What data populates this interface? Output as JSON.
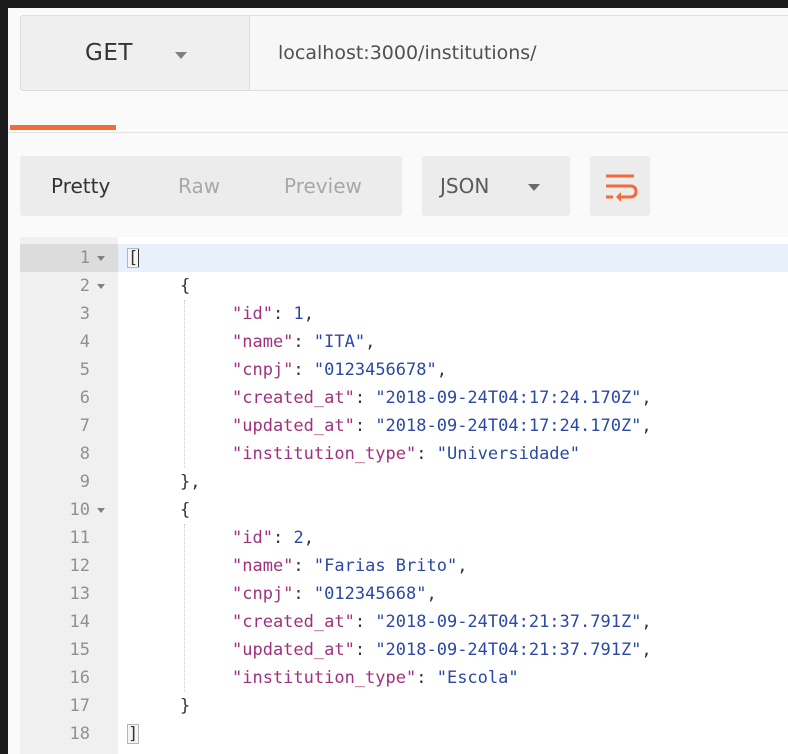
{
  "request": {
    "method": "GET",
    "url": "localhost:3000/institutions/"
  },
  "response_toolbar": {
    "views": [
      "Pretty",
      "Raw",
      "Preview"
    ],
    "active_view": "Pretty",
    "format": "JSON",
    "wrap_icon": "wrap-lines-icon"
  },
  "colors": {
    "accent": "#f26b3a",
    "json_key": "#a0317e",
    "json_value": "#2b49a5"
  },
  "code_lines": [
    {
      "num": "1",
      "indent": 0,
      "fold": true,
      "active": true,
      "tokens": [
        {
          "t": "p",
          "v": "["
        }
      ]
    },
    {
      "num": "2",
      "indent": 1,
      "fold": true,
      "tokens": [
        {
          "t": "p",
          "v": "{"
        }
      ]
    },
    {
      "num": "3",
      "indent": 2,
      "tokens": [
        {
          "t": "k",
          "v": "\"id\""
        },
        {
          "t": "p",
          "v": ": "
        },
        {
          "t": "n",
          "v": "1"
        },
        {
          "t": "p",
          "v": ","
        }
      ]
    },
    {
      "num": "4",
      "indent": 2,
      "tokens": [
        {
          "t": "k",
          "v": "\"name\""
        },
        {
          "t": "p",
          "v": ": "
        },
        {
          "t": "s",
          "v": "\"ITA\""
        },
        {
          "t": "p",
          "v": ","
        }
      ]
    },
    {
      "num": "5",
      "indent": 2,
      "tokens": [
        {
          "t": "k",
          "v": "\"cnpj\""
        },
        {
          "t": "p",
          "v": ": "
        },
        {
          "t": "s",
          "v": "\"0123456678\""
        },
        {
          "t": "p",
          "v": ","
        }
      ]
    },
    {
      "num": "6",
      "indent": 2,
      "tokens": [
        {
          "t": "k",
          "v": "\"created_at\""
        },
        {
          "t": "p",
          "v": ": "
        },
        {
          "t": "s",
          "v": "\"2018-09-24T04:17:24.170Z\""
        },
        {
          "t": "p",
          "v": ","
        }
      ]
    },
    {
      "num": "7",
      "indent": 2,
      "tokens": [
        {
          "t": "k",
          "v": "\"updated_at\""
        },
        {
          "t": "p",
          "v": ": "
        },
        {
          "t": "s",
          "v": "\"2018-09-24T04:17:24.170Z\""
        },
        {
          "t": "p",
          "v": ","
        }
      ]
    },
    {
      "num": "8",
      "indent": 2,
      "tokens": [
        {
          "t": "k",
          "v": "\"institution_type\""
        },
        {
          "t": "p",
          "v": ": "
        },
        {
          "t": "s",
          "v": "\"Universidade\""
        }
      ]
    },
    {
      "num": "9",
      "indent": 1,
      "tokens": [
        {
          "t": "p",
          "v": "},"
        }
      ]
    },
    {
      "num": "10",
      "indent": 1,
      "fold": true,
      "tokens": [
        {
          "t": "p",
          "v": "{"
        }
      ]
    },
    {
      "num": "11",
      "indent": 2,
      "tokens": [
        {
          "t": "k",
          "v": "\"id\""
        },
        {
          "t": "p",
          "v": ": "
        },
        {
          "t": "n",
          "v": "2"
        },
        {
          "t": "p",
          "v": ","
        }
      ]
    },
    {
      "num": "12",
      "indent": 2,
      "tokens": [
        {
          "t": "k",
          "v": "\"name\""
        },
        {
          "t": "p",
          "v": ": "
        },
        {
          "t": "s",
          "v": "\"Farias Brito\""
        },
        {
          "t": "p",
          "v": ","
        }
      ]
    },
    {
      "num": "13",
      "indent": 2,
      "tokens": [
        {
          "t": "k",
          "v": "\"cnpj\""
        },
        {
          "t": "p",
          "v": ": "
        },
        {
          "t": "s",
          "v": "\"012345668\""
        },
        {
          "t": "p",
          "v": ","
        }
      ]
    },
    {
      "num": "14",
      "indent": 2,
      "tokens": [
        {
          "t": "k",
          "v": "\"created_at\""
        },
        {
          "t": "p",
          "v": ": "
        },
        {
          "t": "s",
          "v": "\"2018-09-24T04:21:37.791Z\""
        },
        {
          "t": "p",
          "v": ","
        }
      ]
    },
    {
      "num": "15",
      "indent": 2,
      "tokens": [
        {
          "t": "k",
          "v": "\"updated_at\""
        },
        {
          "t": "p",
          "v": ": "
        },
        {
          "t": "s",
          "v": "\"2018-09-24T04:21:37.791Z\""
        },
        {
          "t": "p",
          "v": ","
        }
      ]
    },
    {
      "num": "16",
      "indent": 2,
      "tokens": [
        {
          "t": "k",
          "v": "\"institution_type\""
        },
        {
          "t": "p",
          "v": ": "
        },
        {
          "t": "s",
          "v": "\"Escola\""
        }
      ]
    },
    {
      "num": "17",
      "indent": 1,
      "tokens": [
        {
          "t": "p",
          "v": "}"
        }
      ]
    },
    {
      "num": "18",
      "indent": 0,
      "bracket": true,
      "tokens": [
        {
          "t": "p",
          "v": "]"
        }
      ]
    }
  ]
}
